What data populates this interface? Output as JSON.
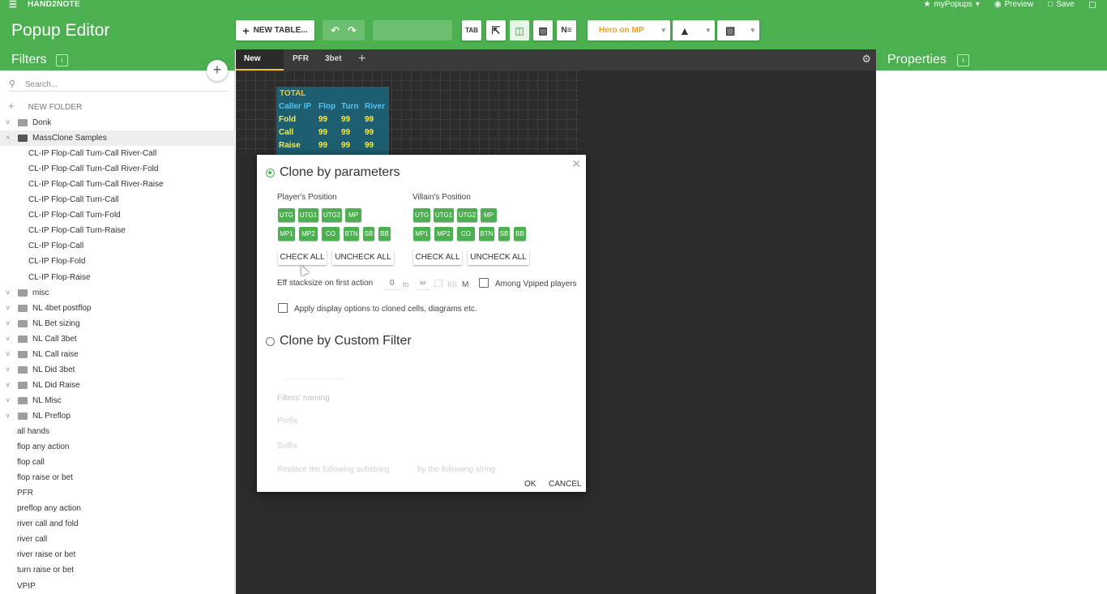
{
  "titlebar": {
    "menu_icon": "hamburger-icon",
    "app_name": "HAND2NOTE",
    "my_popups": "myPopups",
    "preview": "Preview",
    "save": "Save"
  },
  "header": {
    "title": "Popup Editor",
    "new_table": "NEW TABLE...",
    "hero_select": "Hero on MP",
    "colors": {
      "accent": "#4caf50",
      "canvas": "#2c2c2c",
      "hero": "#f0a020"
    }
  },
  "filters": {
    "label": "Filters",
    "search_placeholder": "Search...",
    "new_folder": "NEW FOLDER",
    "tree": [
      {
        "label": "Donk",
        "type": "folder",
        "expanded": true
      },
      {
        "label": "MassClone Samples",
        "type": "folder",
        "expanded": true,
        "selected": true
      },
      {
        "label": "CL-IP Flop-Call Turn-Call River-Call",
        "type": "child"
      },
      {
        "label": "CL-IP Flop-Call Turn-Call River-Fold",
        "type": "child"
      },
      {
        "label": "CL-IP Flop-Call Turn-Call River-Raise",
        "type": "child"
      },
      {
        "label": "CL-IP Flop-Call Turn-Call",
        "type": "child"
      },
      {
        "label": "CL-IP Flop-Call Turn-Fold",
        "type": "child"
      },
      {
        "label": "CL-IP Flop-Call Turn-Raise",
        "type": "child"
      },
      {
        "label": "CL-IP Flop-Call",
        "type": "child"
      },
      {
        "label": "CL-IP Flop-Fold",
        "type": "child"
      },
      {
        "label": "CL-IP Flop-Raise",
        "type": "child"
      },
      {
        "label": "misc",
        "type": "folder"
      },
      {
        "label": "NL 4bet postflop",
        "type": "folder"
      },
      {
        "label": "NL Bet sizing",
        "type": "folder"
      },
      {
        "label": "NL Call 3bet",
        "type": "folder"
      },
      {
        "label": "NL Call raise",
        "type": "folder"
      },
      {
        "label": "NL Did 3bet",
        "type": "folder"
      },
      {
        "label": "NL Did Raise",
        "type": "folder"
      },
      {
        "label": "NL Misc",
        "type": "folder"
      },
      {
        "label": "NL Preflop",
        "type": "folder"
      },
      {
        "label": "all hands",
        "type": "leaf"
      },
      {
        "label": "flop any action",
        "type": "leaf"
      },
      {
        "label": "flop call",
        "type": "leaf"
      },
      {
        "label": "flop raise or bet",
        "type": "leaf"
      },
      {
        "label": "PFR",
        "type": "leaf"
      },
      {
        "label": "preflop any action",
        "type": "leaf"
      },
      {
        "label": "river call and fold",
        "type": "leaf"
      },
      {
        "label": "river call",
        "type": "leaf"
      },
      {
        "label": "river raise or bet",
        "type": "leaf"
      },
      {
        "label": "turn raise or bet",
        "type": "leaf"
      },
      {
        "label": "VPIP",
        "type": "leaf"
      }
    ]
  },
  "tabs": [
    {
      "label": "New Tab",
      "active": true
    },
    {
      "label": "PFR"
    },
    {
      "label": "3bet"
    }
  ],
  "properties": {
    "label": "Properties"
  },
  "stat_table": {
    "title": "TOTAL",
    "headers": [
      "Caller IP",
      "Flop",
      "Turn",
      "River"
    ],
    "rows": [
      {
        "label": "Fold",
        "values": [
          "99",
          "99",
          "99"
        ]
      },
      {
        "label": "Call",
        "values": [
          "99",
          "99",
          "99"
        ]
      },
      {
        "label": "Raise",
        "values": [
          "99",
          "99",
          "99"
        ]
      }
    ]
  },
  "dialog": {
    "section1_title": "Clone by parameters",
    "players_position": "Player's Position",
    "villains_position": "Villain's Position",
    "positions_row1": [
      "UTG",
      "UTG1",
      "UTG2",
      "MP"
    ],
    "positions_row2": [
      "MP1",
      "MP2",
      "CO",
      "BTN",
      "SB",
      "BB"
    ],
    "check_all": "CHECK ALL",
    "uncheck_all": "UNCHECK ALL",
    "eff_stack_label": "Eff stacksize on first action",
    "eff_from": "0",
    "eff_to_label": "to",
    "eff_to": "∞",
    "eff_unit": "BB",
    "eff_m": "M",
    "among_vpiped": "Among Vpiped players",
    "apply_display": "Apply display options to cloned cells, diagrams etc.",
    "section2_title": "Clone by Custom Filter",
    "filters_naming": "Filters' naming",
    "prefix": "Prefix",
    "suffix": "Suffix",
    "replace_label": "Replace the following substring",
    "by_following": "by the following string",
    "ok": "OK",
    "cancel": "CANCEL"
  }
}
